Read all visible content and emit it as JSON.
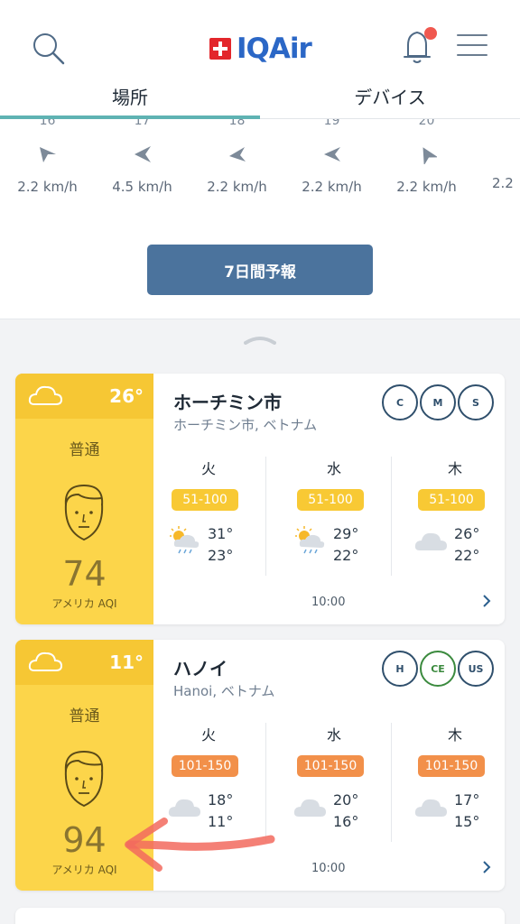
{
  "header": {
    "logo_text": "IQAir",
    "tabs": [
      {
        "label": "場所",
        "active": true
      },
      {
        "label": "デバイス",
        "active": false
      }
    ],
    "notification_dot_color": "#f0584f"
  },
  "wind": {
    "items": [
      {
        "speed": "2.2 km/h",
        "direction": "southwest"
      },
      {
        "speed": "4.5 km/h",
        "direction": "west"
      },
      {
        "speed": "2.2 km/h",
        "direction": "west"
      },
      {
        "speed": "2.2 km/h",
        "direction": "west"
      },
      {
        "speed": "2.2 km/h",
        "direction": "southwest"
      },
      {
        "speed": "2.2",
        "direction": ""
      }
    ],
    "forecast_button": "7日間予報"
  },
  "cities": [
    {
      "name": "ホーチミン市",
      "subtitle": "ホーチミン市, ベトナム",
      "current_temp": "26°",
      "status": "普通",
      "aqi": "74",
      "aqi_unit": "アメリカ AQI",
      "time": "10:00",
      "days": [
        {
          "day": "火",
          "aqi_range": "51-100",
          "weather": "sun-rain",
          "hi": "31°",
          "lo": "23°"
        },
        {
          "day": "水",
          "aqi_range": "51-100",
          "weather": "sun-rain",
          "hi": "29°",
          "lo": "22°"
        },
        {
          "day": "木",
          "aqi_range": "51-100",
          "weather": "cloud",
          "hi": "26°",
          "lo": "22°"
        }
      ]
    },
    {
      "name": "ハノイ",
      "subtitle": "Hanoi, ベトナム",
      "current_temp": "11°",
      "status": "普通",
      "aqi": "94",
      "aqi_unit": "アメリカ AQI",
      "time": "10:00",
      "days": [
        {
          "day": "火",
          "aqi_range": "101-150",
          "weather": "cloud",
          "hi": "18°",
          "lo": "11°"
        },
        {
          "day": "水",
          "aqi_range": "101-150",
          "weather": "cloud",
          "hi": "20°",
          "lo": "16°"
        },
        {
          "day": "木",
          "aqi_range": "101-150",
          "weather": "cloud",
          "hi": "17°",
          "lo": "15°"
        }
      ]
    }
  ],
  "colors": {
    "accent_teal": "#5fb3b3",
    "button_blue": "#4b739d",
    "aqi_moderate_yellow": "#fcd54a",
    "badge_yellow": "#f8c934",
    "badge_orange": "#f2904a",
    "annotation_arrow": "#f26a5e"
  }
}
